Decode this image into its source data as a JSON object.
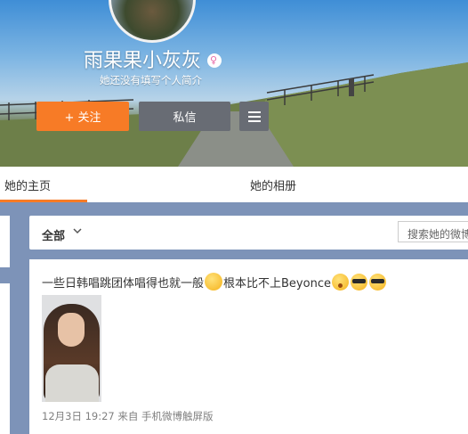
{
  "profile": {
    "username": "雨果果小灰灰",
    "gender_symbol": "♀",
    "bio": "她还没有填写个人简介",
    "follow_label": "+ 关注",
    "message_label": "私信",
    "menu_icon": "hamburger-icon"
  },
  "tabs": [
    "她的主页",
    "她的相册"
  ],
  "feed": {
    "filter_label": "全部",
    "search_placeholder": "搜索她的微博"
  },
  "post": {
    "text_part1": "一些日韩唱跳团体唱得也就一般",
    "text_part2": "根本比不上Beyonce",
    "time": "12月3日 19:27",
    "source": "来自 手机微博触屏版"
  },
  "colors": {
    "accent": "#f77b26",
    "secondary_button": "#686c74",
    "gender_pink": "#e86aa8"
  }
}
